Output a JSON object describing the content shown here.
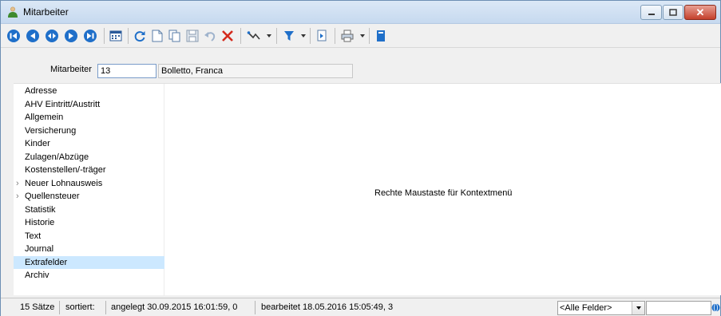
{
  "window": {
    "title": "Mitarbeiter",
    "title_icon": "people-icon"
  },
  "toolbar": {
    "buttons": [
      "first-record-icon",
      "previous-record-icon",
      "record-list-icon",
      "next-record-icon",
      "last-record-icon",
      "calendar-icon",
      "refresh-icon",
      "new-record-icon",
      "copy-record-icon",
      "save-icon",
      "undo-icon",
      "delete-icon",
      "link-icon",
      "filter-icon",
      "export-icon",
      "print-icon",
      "help-icon"
    ]
  },
  "fields": {
    "mitarbeiter_label": "Mitarbeiter",
    "mitarbeiter_value": "13",
    "name_value": "Bolletto, Franca"
  },
  "tree": {
    "items": [
      {
        "label": "Adresse",
        "expandable": false
      },
      {
        "label": "AHV Eintritt/Austritt",
        "expandable": false
      },
      {
        "label": "Allgemein",
        "expandable": false
      },
      {
        "label": "Versicherung",
        "expandable": false
      },
      {
        "label": "Kinder",
        "expandable": false
      },
      {
        "label": "Zulagen/Abzüge",
        "expandable": false
      },
      {
        "label": "Kostenstellen/-träger",
        "expandable": false
      },
      {
        "label": "Neuer Lohnausweis",
        "expandable": true
      },
      {
        "label": "Quellensteuer",
        "expandable": true
      },
      {
        "label": "Statistik",
        "expandable": false
      },
      {
        "label": "Historie",
        "expandable": false
      },
      {
        "label": "Text",
        "expandable": false
      },
      {
        "label": "Journal",
        "expandable": false
      },
      {
        "label": "Extrafelder",
        "expandable": false,
        "selected": true
      },
      {
        "label": "Archiv",
        "expandable": false
      }
    ]
  },
  "content": {
    "hint": "Rechte Maustaste für Kontextmenü"
  },
  "status": {
    "count": "15 Sätze",
    "sorted_label": "sortiert:",
    "created": "angelegt 30.09.2015 16:01:59,  0",
    "edited": "bearbeitet 18.05.2016 15:05:49,  3",
    "field_filter": "<Alle Felder>",
    "search_value": ""
  },
  "colors": {
    "selection": "#cce8ff",
    "nav_blue": "#1f6fc9",
    "delete_red": "#d42a1c",
    "close_red": "#c4402c"
  }
}
